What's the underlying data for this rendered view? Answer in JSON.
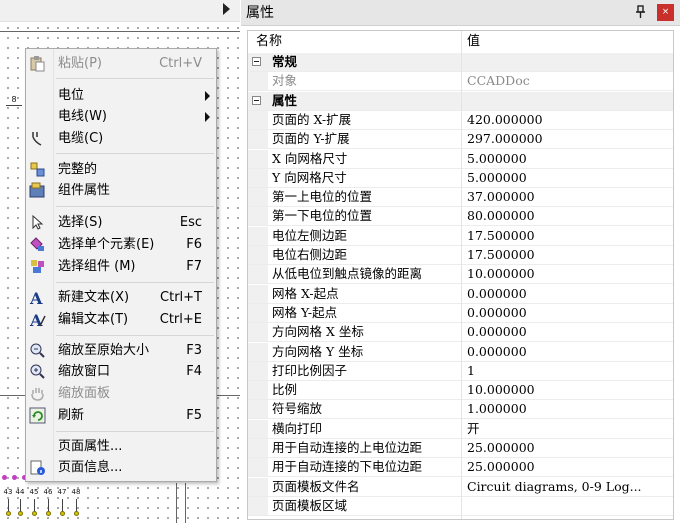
{
  "canvas": {
    "ruler_label": "8",
    "terminals": [
      "43",
      "44",
      "45",
      "46",
      "47",
      "48"
    ]
  },
  "menu": {
    "items": [
      {
        "label": "粘贴(P)",
        "shortcut": "Ctrl+V",
        "disabled": true,
        "icon": "paste-icon"
      },
      {
        "label": "电位",
        "submenu": true
      },
      {
        "label": "电线(W)",
        "submenu": true
      },
      {
        "label": "电缆(C)",
        "icon": "cable-icon"
      },
      {
        "label": "完整的",
        "icon": "complete-icon"
      },
      {
        "label": "组件属性",
        "icon": "component-properties-icon"
      },
      {
        "label": "选择(S)",
        "shortcut": "Esc",
        "icon": "cursor-icon"
      },
      {
        "label": "选择单个元素(E)",
        "shortcut": "F6",
        "icon": "select-single-icon"
      },
      {
        "label": "选择组件 (M)",
        "shortcut": "F7",
        "icon": "select-component-icon"
      },
      {
        "label": "新建文本(X)",
        "shortcut": "Ctrl+T",
        "icon": "new-text-icon"
      },
      {
        "label": "编辑文本(T)",
        "shortcut": "Ctrl+E",
        "icon": "edit-text-icon"
      },
      {
        "label": "缩放至原始大小",
        "shortcut": "F3",
        "icon": "zoom-original-icon"
      },
      {
        "label": "缩放窗口",
        "shortcut": "F4",
        "icon": "zoom-window-icon"
      },
      {
        "label": "缩放面板",
        "disabled": true,
        "icon": "pan-hand-icon"
      },
      {
        "label": "刷新",
        "shortcut": "F5",
        "icon": "refresh-icon"
      },
      {
        "label": "页面属性..."
      },
      {
        "label": "页面信息...",
        "icon": "page-info-icon"
      }
    ]
  },
  "panel": {
    "title": "属性",
    "pin_icon": "pin-icon",
    "close_icon": "close-icon",
    "columns": {
      "name": "名称",
      "value": "值"
    },
    "categories": [
      {
        "label": "常规",
        "rows": [
          {
            "name": "对象",
            "value": "CCADDoc",
            "dim": true
          }
        ]
      },
      {
        "label": "属性",
        "rows": [
          {
            "name": "页面的 X-扩展",
            "value": "420.000000"
          },
          {
            "name": "页面的 Y-扩展",
            "value": "297.000000"
          },
          {
            "name": "X 向网格尺寸",
            "value": "5.000000"
          },
          {
            "name": "Y 向网格尺寸",
            "value": "5.000000"
          },
          {
            "name": "第一上电位的位置",
            "value": "37.000000"
          },
          {
            "name": "第一下电位的位置",
            "value": "80.000000"
          },
          {
            "name": "电位左侧边距",
            "value": "17.500000"
          },
          {
            "name": "电位右侧边距",
            "value": "17.500000"
          },
          {
            "name": "从低电位到触点镜像的距离",
            "value": "10.000000"
          },
          {
            "name": "网格 X-起点",
            "value": "0.000000"
          },
          {
            "name": "网格 Y-起点",
            "value": "0.000000"
          },
          {
            "name": "方向网格 X 坐标",
            "value": "0.000000"
          },
          {
            "name": "方向网格 Y 坐标",
            "value": "0.000000"
          },
          {
            "name": "打印比例因子",
            "value": "1"
          },
          {
            "name": "比例",
            "value": "10.000000"
          },
          {
            "name": "符号缩放",
            "value": "1.000000"
          },
          {
            "name": "横向打印",
            "value": "开"
          },
          {
            "name": "用于自动连接的上电位边距",
            "value": "25.000000"
          },
          {
            "name": "用于自动连接的下电位边距",
            "value": "25.000000"
          },
          {
            "name": "页面模板文件名",
            "value": "Circuit diagrams, 0-9 Log..."
          },
          {
            "name": "页面模板区域",
            "value": ""
          }
        ]
      }
    ]
  }
}
